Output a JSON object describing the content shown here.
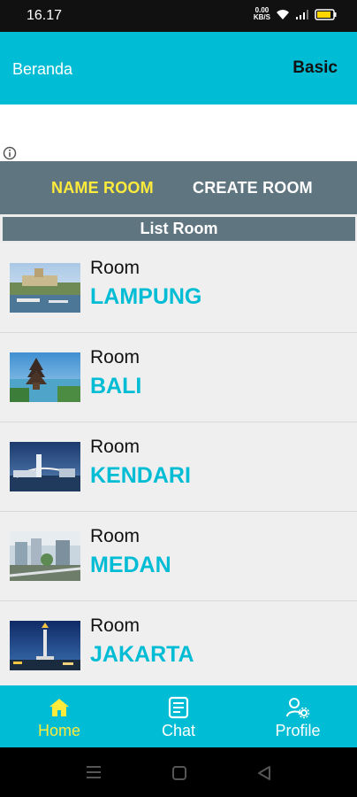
{
  "status": {
    "time": "16.17",
    "net_speed_value": "0.00",
    "net_speed_unit": "KB/S"
  },
  "app_bar": {
    "title": "Beranda",
    "action": "Basic"
  },
  "tabs": [
    {
      "label": "NAME ROOM",
      "active": true
    },
    {
      "label": "CREATE ROOM",
      "active": false
    }
  ],
  "list_header": "List Room",
  "rooms": [
    {
      "label": "Room",
      "city": "LAMPUNG"
    },
    {
      "label": "Room",
      "city": "BALI"
    },
    {
      "label": "Room",
      "city": "KENDARI"
    },
    {
      "label": "Room",
      "city": "MEDAN"
    },
    {
      "label": "Room",
      "city": "JAKARTA"
    }
  ],
  "bottom_nav": [
    {
      "label": "Home",
      "icon": "home-icon",
      "active": true
    },
    {
      "label": "Chat",
      "icon": "chat-icon",
      "active": false
    },
    {
      "label": "Profile",
      "icon": "profile-settings-icon",
      "active": false
    }
  ],
  "colors": {
    "primary": "#00bcd4",
    "tab_bar": "#5f7681",
    "active_accent": "#ffeb3b"
  }
}
